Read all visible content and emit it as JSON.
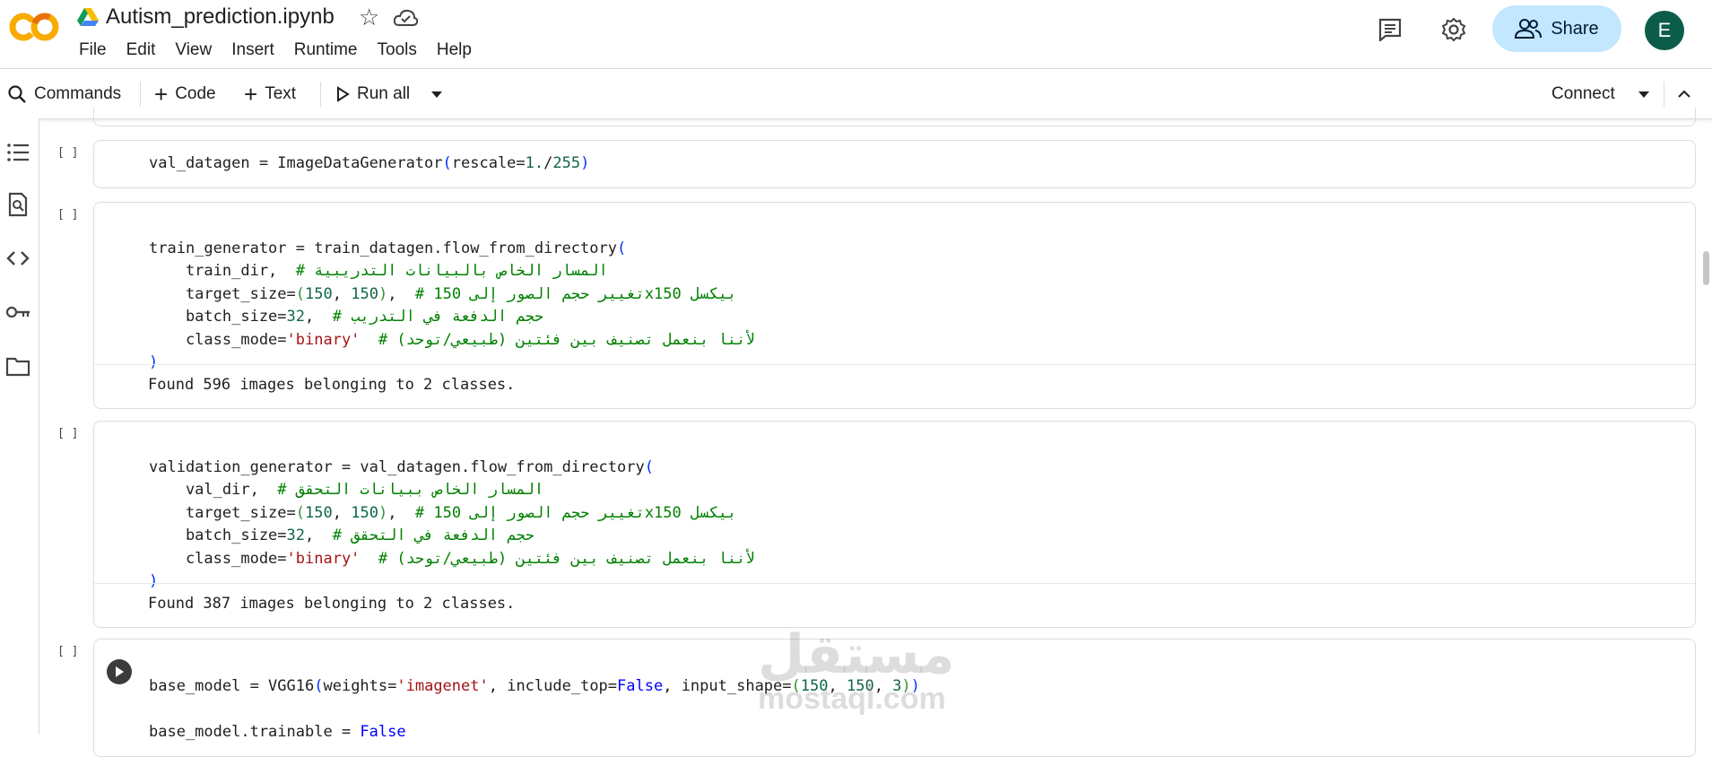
{
  "app": {
    "logo_text": "CO"
  },
  "notebook": {
    "title": "Autism_prediction.ipynb"
  },
  "menu": [
    "File",
    "Edit",
    "View",
    "Insert",
    "Runtime",
    "Tools",
    "Help"
  ],
  "header": {
    "share_label": "Share",
    "avatar_letter": "E"
  },
  "toolbar": {
    "commands": "Commands",
    "code": "Code",
    "text": "Text",
    "run_all": "Run all",
    "connect": "Connect"
  },
  "cells": {
    "bracket": "[ ]",
    "c1": {
      "line1": {
        "a": "val_datagen = ImageDataGenerator",
        "b": "(",
        "c": "rescale=",
        "d": "1.",
        "e": "/",
        "f": "255",
        "g": ")"
      }
    },
    "c2": {
      "l1": {
        "a": "train_generator = train_datagen.flow_from_directory",
        "b": "("
      },
      "l2": {
        "a": "    train_dir,  ",
        "c": "# المسار الخاص بالبيانات التدريبية"
      },
      "l3": {
        "a": "    target_size=",
        "b": "(",
        "n1": "150",
        "s": ", ",
        "n2": "150",
        "b2": ")",
        "t": ",  ",
        "c": "# تغيير حجم الصور إلى 150x150 بيكسل"
      },
      "l4": {
        "a": "    batch_size=",
        "n": "32",
        "t": ",  ",
        "c": "# حجم الدفعة في التدريب"
      },
      "l5": {
        "a": "    class_mode=",
        "s": "'binary'",
        "t": "  ",
        "c": "# لأننا بنعمل تصنيف بين فئتين (طبيعي/توحد)"
      },
      "l6": {
        "b": ")"
      },
      "output": "Found 596 images belonging to 2 classes."
    },
    "c3": {
      "l1": {
        "a": "validation_generator = val_datagen.flow_from_directory",
        "b": "("
      },
      "l2": {
        "a": "    val_dir,  ",
        "c": "# المسار الخاص ببيانات التحقق"
      },
      "l3": {
        "a": "    target_size=",
        "b": "(",
        "n1": "150",
        "s": ", ",
        "n2": "150",
        "b2": ")",
        "t": ",  ",
        "c": "# تغيير حجم الصور إلى 150x150 بيكسل"
      },
      "l4": {
        "a": "    batch_size=",
        "n": "32",
        "t": ",  ",
        "c": "# حجم الدفعة في التحقق"
      },
      "l5": {
        "a": "    class_mode=",
        "s": "'binary'",
        "t": "  ",
        "c": "# لأننا بنعمل تصنيف بين فئتين (طبيعي/توحد)"
      },
      "l6": {
        "b": ")"
      },
      "output": "Found 387 images belonging to 2 classes."
    },
    "c4": {
      "l1": {
        "a": "base_model = VGG16",
        "b": "(",
        "c": "weights=",
        "s": "'imagenet'",
        "d": ", include_top=",
        "k": "False",
        "e": ", input_shape=",
        "b2": "(",
        "n1": "150",
        "s1": ", ",
        "n2": "150",
        "s2": ", ",
        "n3": "3",
        "b3": ")",
        "b4": ")"
      },
      "l2": {
        "a": "base_model.trainable = ",
        "k": "False"
      }
    }
  },
  "watermark": {
    "ar": "مستقل",
    "en": "mostaql.com"
  },
  "colors": {
    "share_bg": "#c2e7ff",
    "avatar_bg": "#0b5d4a",
    "comment": "#008000",
    "string": "#a31515",
    "number": "#116644",
    "keyword": "#0000ff"
  }
}
